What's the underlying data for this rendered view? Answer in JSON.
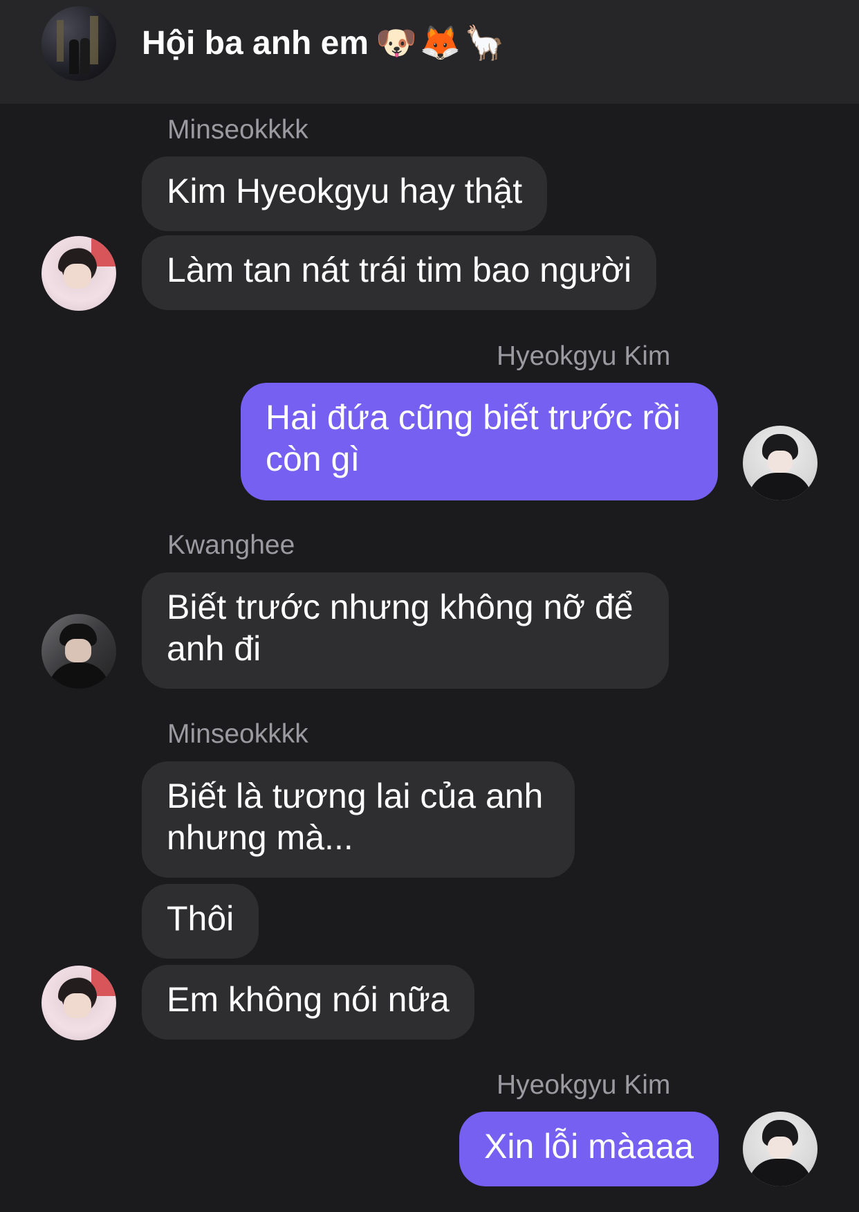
{
  "header": {
    "title": "Hội ba anh em",
    "emojis": "🐶🦊🦙"
  },
  "messages": [
    {
      "sender": "Minseokkkk",
      "texts": [
        "Kim Hyeokgyu hay thật",
        "Làm tan nát trái tim bao người"
      ]
    },
    {
      "sender": "Hyeokgyu Kim",
      "texts": [
        "Hai đứa cũng biết trước rồi",
        "còn gì"
      ]
    },
    {
      "sender": "Kwanghee",
      "texts": [
        "Biết trước nhưng không nỡ để",
        "anh đi"
      ]
    },
    {
      "sender": "Minseokkkk",
      "texts": [
        "Biết là tương lai của anh",
        "nhưng mà...",
        "Thôi",
        "Em không nói nữa"
      ]
    },
    {
      "sender": "Hyeokgyu Kim",
      "texts": [
        "Xin lỗi màaaa"
      ]
    }
  ],
  "colors": {
    "background": "#1b1b1d",
    "header": "#262628",
    "incoming_bubble": "#2e2e31",
    "outgoing_bubble": "#7560f2",
    "sender_name": "#9a9aa0"
  }
}
